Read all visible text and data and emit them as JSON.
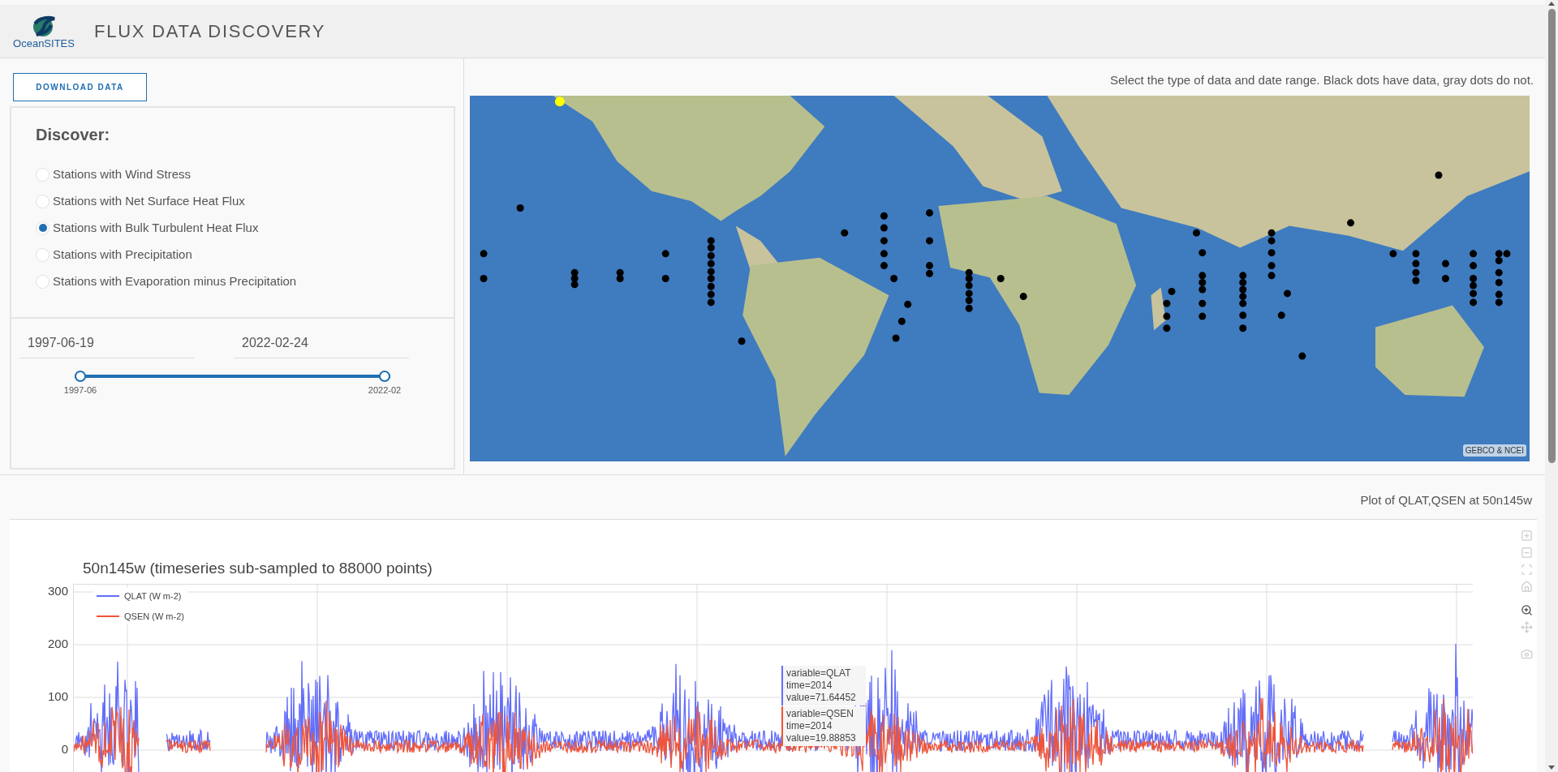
{
  "header": {
    "logo_text": "OceanSITES",
    "title": "FLUX DATA DISCOVERY"
  },
  "download_button": "DOWNLOAD DATA",
  "discover": {
    "heading": "Discover:",
    "options": [
      {
        "label": "Stations with Wind Stress",
        "selected": false
      },
      {
        "label": "Stations with Net Surface Heat Flux",
        "selected": false
      },
      {
        "label": "Stations with Bulk Turbulent Heat Flux",
        "selected": true
      },
      {
        "label": "Stations with Precipitation",
        "selected": false
      },
      {
        "label": "Stations with Evaporation minus Precipitation",
        "selected": false
      }
    ]
  },
  "date_range": {
    "start": "1997-06-19",
    "end": "2022-02-24",
    "thumbs": [
      {
        "level": 0,
        "label": "1997-06"
      },
      {
        "level": 1,
        "label": "2022-02"
      }
    ]
  },
  "map": {
    "instruction": "Select the type of data and date range. Black dots have data, gray dots do not.",
    "attribution": "GEBCO & NCEI"
  },
  "plot": {
    "caption": "Plot of QLAT,QSEN at 50n145w",
    "title": "50n145w (timeseries sub-sampled to 88000 points)",
    "y_tick_labels": [
      "300",
      "200",
      "100",
      "0"
    ],
    "legend": [
      {
        "label": "QLAT (W m-2)",
        "color": "#636efa"
      },
      {
        "label": "QSEN (W m-2)",
        "color": "#ef553b"
      }
    ],
    "tooltips": [
      {
        "lines": [
          "variable=QLAT",
          "time=2014",
          "value=71.64452"
        ],
        "color": "#636efa"
      },
      {
        "lines": [
          "variable=QSEN",
          "time=2014",
          "value=19.88853"
        ],
        "color": "#ef553b"
      }
    ],
    "modebar": [
      {
        "kind": "zoom_in",
        "selected": false
      },
      {
        "kind": "zoom_out",
        "selected": false
      },
      {
        "kind": "autoscale",
        "selected": false
      },
      {
        "kind": "home",
        "selected": false
      },
      {
        "kind": "zoom",
        "selected": true
      },
      {
        "kind": "pan",
        "selected": false
      },
      {
        "kind": "camera",
        "selected": false
      }
    ]
  }
}
